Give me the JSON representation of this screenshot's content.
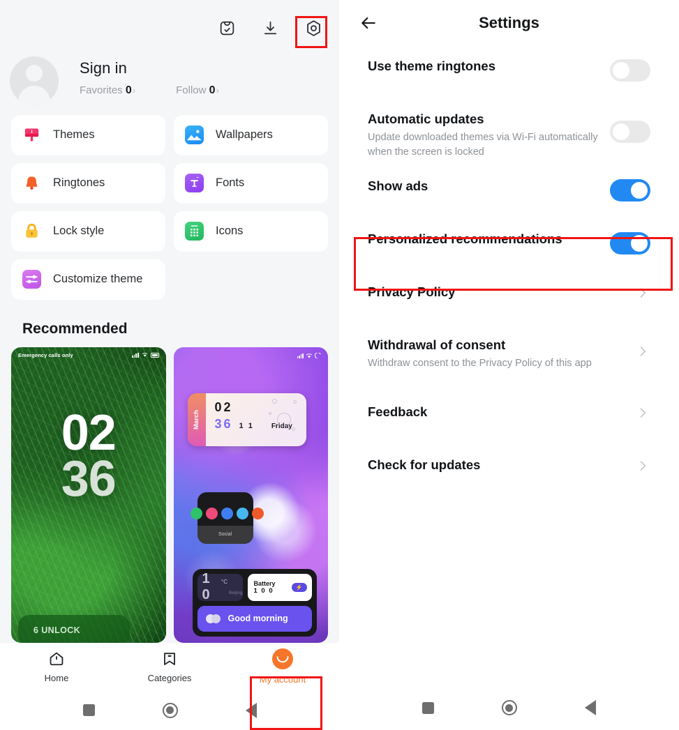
{
  "left_app": {
    "topbar_icons": [
      {
        "name": "mi-box-check-icon",
        "label": "Mi picks"
      },
      {
        "name": "download-icon",
        "label": "Downloads"
      },
      {
        "name": "gear-settings-icon",
        "label": "Settings"
      }
    ],
    "profile": {
      "avatar": "default-avatar",
      "sign_in": "Sign in",
      "stats": [
        {
          "label": "Favorites",
          "value": "0",
          "chevron": "›"
        },
        {
          "label": "Follow",
          "value": "0",
          "chevron": "›"
        }
      ]
    },
    "tiles": [
      {
        "label": "Themes",
        "icon": "themes-icon",
        "color": "#f2346a"
      },
      {
        "label": "Wallpapers",
        "icon": "wallpapers-icon",
        "color": "#1b8af0"
      },
      {
        "label": "Ringtones",
        "icon": "ringtones-bell-icon",
        "color": "#f4622a"
      },
      {
        "label": "Fonts",
        "icon": "fonts-icon",
        "color": "#8b3ef0"
      },
      {
        "label": "Lock style",
        "icon": "lock-style-icon",
        "color": "#f6b31e"
      },
      {
        "label": "Icons",
        "icon": "icons-grid-icon",
        "color": "#22b85f"
      },
      {
        "label": "Customize theme",
        "icon": "customize-theme-sliders-icon",
        "color": "#c052e8"
      }
    ],
    "recommended": {
      "heading": "Recommended",
      "items": [
        {
          "name": "green-grass-lockscreen-theme",
          "status_text": "Emergency calls only",
          "clock_hours": "02",
          "clock_minutes": "36",
          "unlock_text": "6 UNLOCK"
        },
        {
          "name": "purple-splash-theme",
          "widget_month": "March",
          "clock_hours": "02",
          "clock_minutes": "36",
          "date_day": "1 1",
          "weekday": "Friday",
          "social_label": "Social",
          "temperature": "1 0",
          "temperature_unit": "°C",
          "temperature_sub": "Beijing",
          "battery_label": "Battery",
          "battery_value": "1 0 0",
          "greeting": "Good morning"
        }
      ]
    },
    "tabbar": [
      {
        "label": "Home",
        "icon": "home-icon",
        "active": false
      },
      {
        "label": "Categories",
        "icon": "bookmark-icon",
        "active": false
      },
      {
        "label": "My account",
        "icon": "account-face-icon",
        "active": true
      }
    ],
    "navbar": [
      {
        "name": "recents-square-icon"
      },
      {
        "name": "home-circle-icon"
      },
      {
        "name": "back-triangle-icon"
      }
    ]
  },
  "right_app": {
    "header": {
      "back": "back-arrow-icon",
      "title": "Settings"
    },
    "settings": [
      {
        "label": "Use theme ringtones",
        "sub": "",
        "control": "toggle",
        "state": "off"
      },
      {
        "label": "Automatic updates",
        "sub": "Update downloaded themes via Wi-Fi automatically when the screen is locked",
        "control": "toggle",
        "state": "off"
      },
      {
        "label": "Show ads",
        "sub": "",
        "control": "toggle",
        "state": "on"
      },
      {
        "label": "Personalized recommendations",
        "sub": "",
        "control": "toggle",
        "state": "on"
      },
      {
        "label": "Privacy Policy",
        "sub": "",
        "control": "chevron",
        "state": ""
      },
      {
        "label": "Withdrawal of consent",
        "sub": "Withdraw consent to the Privacy Policy of this app",
        "control": "chevron",
        "state": ""
      },
      {
        "label": "Feedback",
        "sub": "",
        "control": "chevron",
        "state": ""
      },
      {
        "label": "Check for updates",
        "sub": "",
        "control": "chevron",
        "state": ""
      }
    ],
    "navbar": [
      {
        "name": "recents-square-icon"
      },
      {
        "name": "home-circle-icon"
      },
      {
        "name": "back-triangle-icon"
      }
    ]
  },
  "annotations": {
    "accent_color": "#f11414",
    "highlights": [
      {
        "target": "gear-settings-icon"
      },
      {
        "target": "tab-my-account"
      },
      {
        "target": "setting-personalized-recommendations"
      }
    ]
  }
}
